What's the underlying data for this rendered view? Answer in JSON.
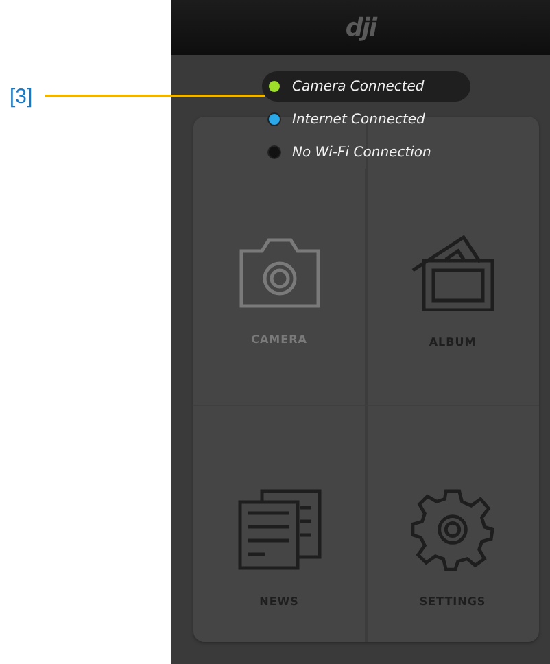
{
  "callout": {
    "label": "[3]"
  },
  "header": {
    "logo": "dji"
  },
  "status": [
    {
      "label": "Camera Connected",
      "color": "#9ee02a",
      "highlighted": true
    },
    {
      "label": "Internet Connected",
      "color": "#2aa8e8",
      "highlighted": false
    },
    {
      "label": "No Wi-Fi Connection",
      "color": "#111111",
      "highlighted": false
    }
  ],
  "tiles": [
    {
      "kind": "camera",
      "label": "CAMERA",
      "disabled": true
    },
    {
      "kind": "album",
      "label": "ALBUM",
      "disabled": false
    },
    {
      "kind": "news",
      "label": "NEWS",
      "disabled": false
    },
    {
      "kind": "settings",
      "label": "SETTINGS",
      "disabled": false
    }
  ]
}
